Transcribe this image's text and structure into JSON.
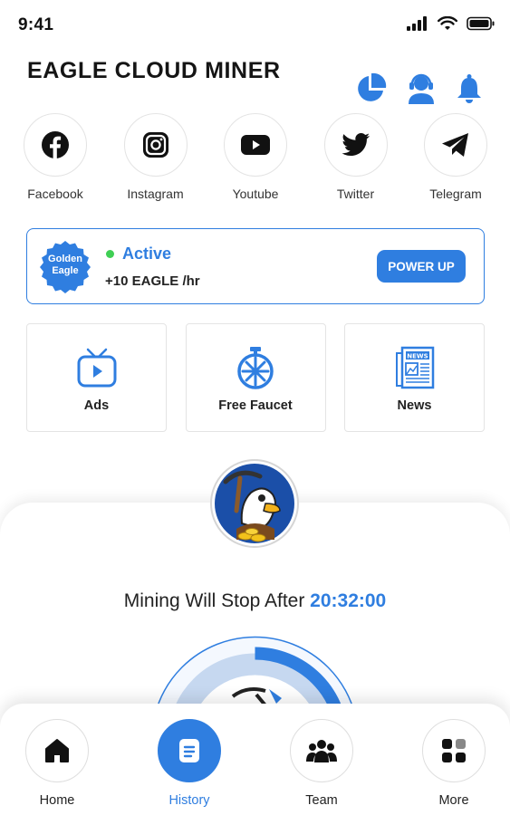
{
  "status_bar": {
    "time": "9:41"
  },
  "header": {
    "title": "EAGLE CLOUD MINER",
    "icons": [
      "pie-chart-icon",
      "support-agent-icon",
      "bell-icon"
    ]
  },
  "social": [
    {
      "label": "Facebook",
      "icon": "facebook-icon"
    },
    {
      "label": "Instagram",
      "icon": "instagram-icon"
    },
    {
      "label": "Youtube",
      "icon": "youtube-icon"
    },
    {
      "label": "Twitter",
      "icon": "twitter-icon"
    },
    {
      "label": "Telegram",
      "icon": "telegram-icon"
    }
  ],
  "active_card": {
    "badge_line1": "Golden",
    "badge_line2": "Eagle",
    "status": "Active",
    "rate": "+10 EAGLE /hr",
    "button": "POWER UP"
  },
  "tiles": [
    {
      "label": "Ads",
      "icon": "tv-play-icon"
    },
    {
      "label": "Free Faucet",
      "icon": "faucet-wheel-icon"
    },
    {
      "label": "News",
      "icon": "newspaper-icon"
    }
  ],
  "mining": {
    "label": "Mining Will Stop After ",
    "timer": "20:32:00"
  },
  "nav": [
    {
      "label": "Home",
      "icon": "home-icon",
      "active": false
    },
    {
      "label": "History",
      "icon": "history-document-icon",
      "active": true
    },
    {
      "label": "Team",
      "icon": "team-icon",
      "active": false
    },
    {
      "label": "More",
      "icon": "grid-more-icon",
      "active": false
    }
  ],
  "colors": {
    "accent": "#2f7ee0",
    "active_dot": "#3fcf54",
    "text": "#222222"
  }
}
